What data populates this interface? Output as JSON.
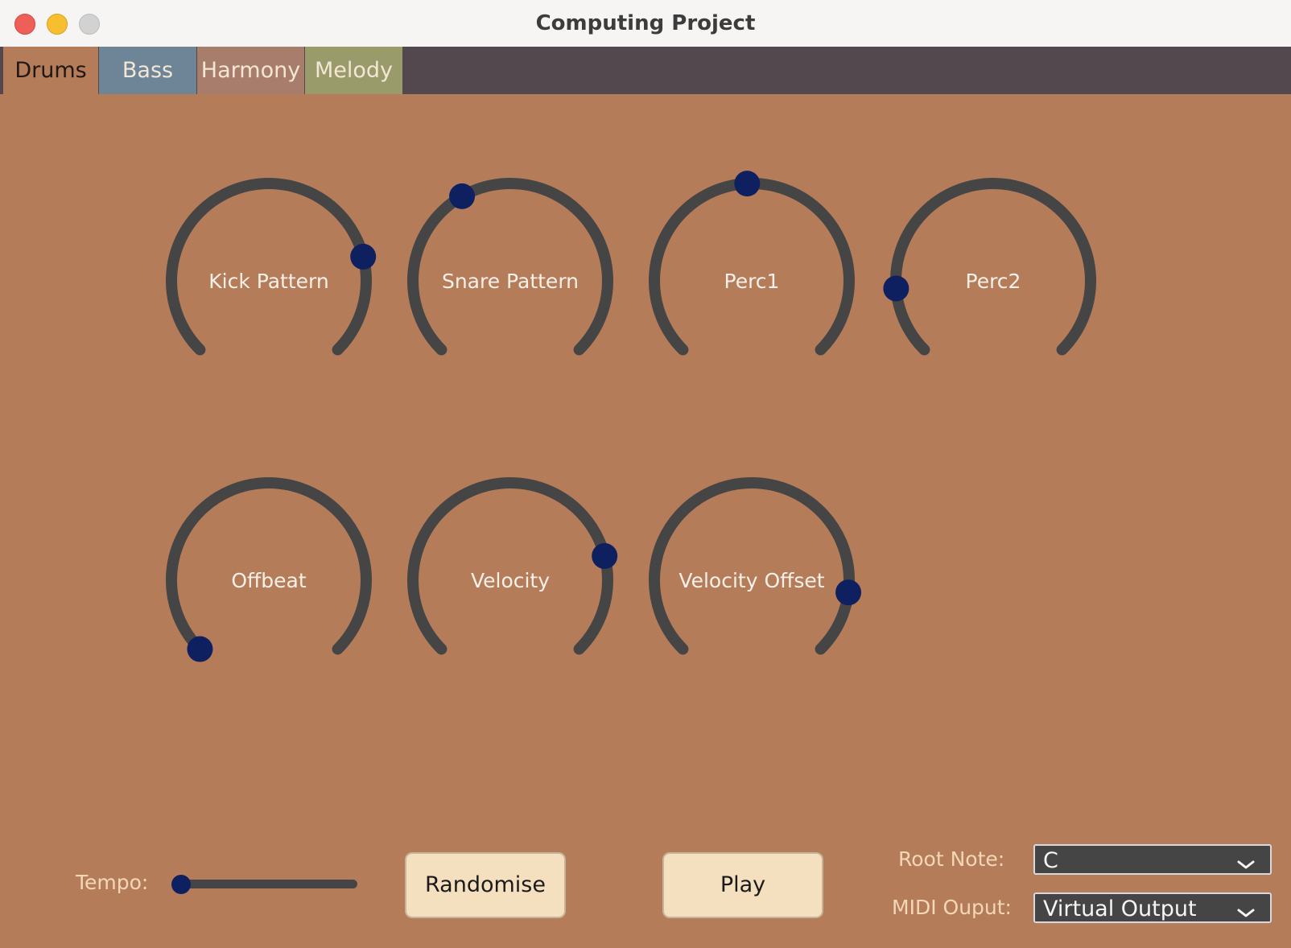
{
  "window": {
    "title": "Computing Project"
  },
  "tabs": [
    {
      "label": "Drums",
      "selected": true,
      "color": "#b57c5a"
    },
    {
      "label": "Bass",
      "selected": false,
      "color": "#6d8597"
    },
    {
      "label": "Harmony",
      "selected": false,
      "color": "#a97d6c"
    },
    {
      "label": "Melody",
      "selected": false,
      "color": "#9a9b6b"
    }
  ],
  "knobs": [
    {
      "label": "Kick Pattern",
      "value": 0.78
    },
    {
      "label": "Snare Pattern",
      "value": 0.39
    },
    {
      "label": "Perc1",
      "value": 0.49
    },
    {
      "label": "Perc2",
      "value": 0.15
    },
    {
      "label": "Offbeat",
      "value": 0.0
    },
    {
      "label": "Velocity",
      "value": 0.78
    },
    {
      "label": "Velocity Offset",
      "value": 0.86
    }
  ],
  "tempo": {
    "label": "Tempo:",
    "value": 0.0
  },
  "buttons": {
    "randomise": "Randomise",
    "play": "Play"
  },
  "root_note": {
    "label": "Root Note:",
    "value": "C"
  },
  "midi_output": {
    "label": "MIDI Ouput:",
    "value": "Virtual Output"
  },
  "colors": {
    "background": "#b57c5a",
    "tabbar": "#52484d",
    "knob_track": "#454545",
    "knob_thumb": "#0f2060",
    "button": "#f4dfbf"
  }
}
